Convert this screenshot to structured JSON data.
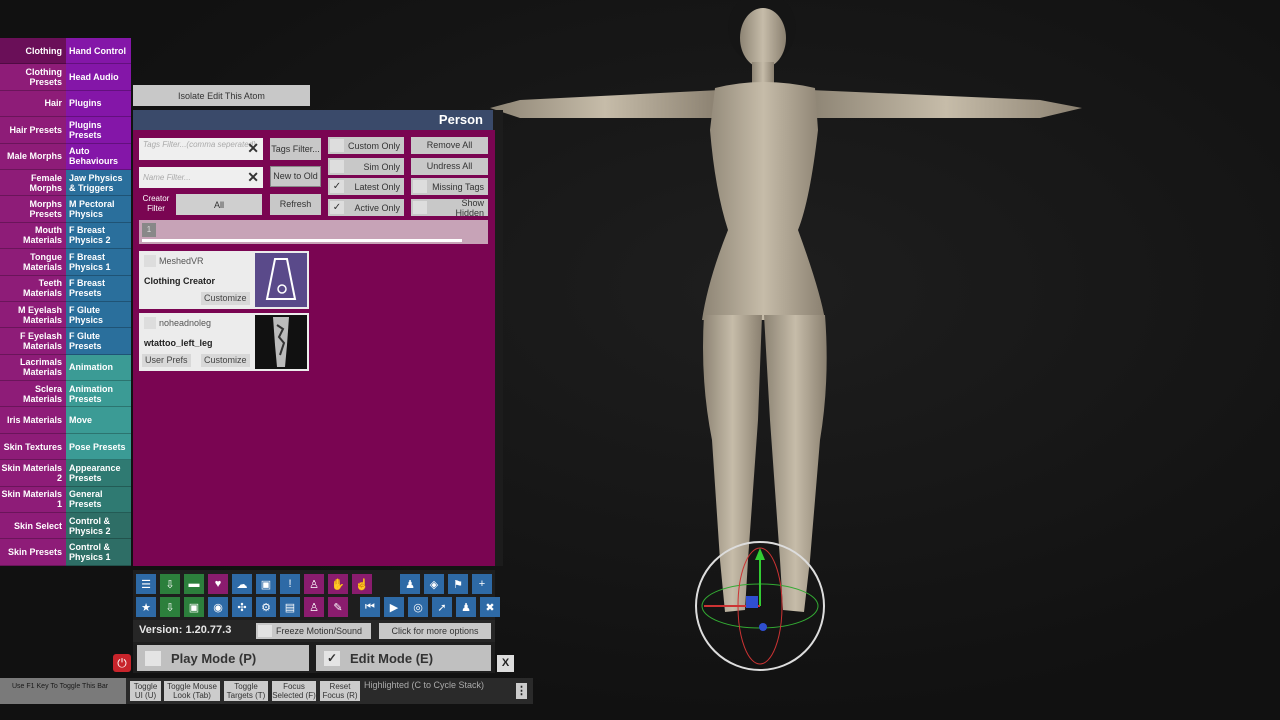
{
  "left_tabs": [
    {
      "label": "Clothing",
      "active": true
    },
    {
      "label": "Clothing Presets"
    },
    {
      "label": "Hair"
    },
    {
      "label": "Hair Presets"
    },
    {
      "label": "Male Morphs"
    },
    {
      "label": "Female Morphs"
    },
    {
      "label": "Morphs Presets"
    },
    {
      "label": "Mouth Materials"
    },
    {
      "label": "Tongue Materials"
    },
    {
      "label": "Teeth Materials"
    },
    {
      "label": "M Eyelash Materials"
    },
    {
      "label": "F Eyelash Materials"
    },
    {
      "label": "Lacrimals Materials"
    },
    {
      "label": "Sclera Materials"
    },
    {
      "label": "Iris Materials"
    },
    {
      "label": "Skin Textures"
    },
    {
      "label": "Skin Materials 2"
    },
    {
      "label": "Skin Materials 1"
    },
    {
      "label": "Skin Select"
    },
    {
      "label": "Skin Presets"
    }
  ],
  "right_tabs": [
    {
      "label": "Hand Control",
      "color": "purple"
    },
    {
      "label": "Head Audio",
      "color": "purple"
    },
    {
      "label": "Plugins",
      "color": "purple"
    },
    {
      "label": "Plugins Presets",
      "color": "purple"
    },
    {
      "label": "Auto Behaviours",
      "color": "purple"
    },
    {
      "label": "Jaw Physics & Triggers",
      "color": "blue"
    },
    {
      "label": "M Pectoral Physics",
      "color": "blue"
    },
    {
      "label": "F Breast Physics 2",
      "color": "blue"
    },
    {
      "label": "F Breast Physics 1",
      "color": "blue"
    },
    {
      "label": "F Breast Presets",
      "color": "blue"
    },
    {
      "label": "F Glute Physics",
      "color": "blue"
    },
    {
      "label": "F Glute Presets",
      "color": "blue"
    },
    {
      "label": "Animation",
      "color": "teal"
    },
    {
      "label": "Animation Presets",
      "color": "teal"
    },
    {
      "label": "Move",
      "color": "teal"
    },
    {
      "label": "Pose Presets",
      "color": "teal"
    },
    {
      "label": "Appearance Presets",
      "color": "dteal"
    },
    {
      "label": "General Presets",
      "color": "dteal"
    },
    {
      "label": "Control & Physics 2",
      "color": "gteal"
    },
    {
      "label": "Control & Physics 1",
      "color": "gteal"
    }
  ],
  "isolate_button": "Isolate Edit This Atom",
  "panel": {
    "title": "Person",
    "tags_filter_placeholder": "Tags Filter...(comma seperated)",
    "name_filter_placeholder": "Name Filter...",
    "tags_filter_button": "Tags Filter...",
    "sort_button": "New to Old",
    "refresh_button": "Refresh",
    "creator_filter_label": "Creator Filter",
    "creator_filter_value": "All",
    "toggles": [
      {
        "label": "Custom Only",
        "checked": false
      },
      {
        "label": "Sim Only",
        "checked": false
      },
      {
        "label": "Latest Only",
        "checked": true
      },
      {
        "label": "Active Only",
        "checked": true
      }
    ],
    "right_buttons": {
      "remove_all": "Remove All",
      "undress_all": "Undress All",
      "missing_tags": "Missing Tags",
      "show_hidden": "Show Hidden"
    },
    "page_number": "1",
    "items": [
      {
        "creator": "MeshedVR",
        "name": "Clothing Creator",
        "buttons": [
          "Customize"
        ]
      },
      {
        "creator": "noheadnoleg",
        "name": "wtattoo_left_leg",
        "buttons": [
          "User Prefs",
          "Customize"
        ]
      }
    ]
  },
  "toolbar": {
    "version": "Version: 1.20.77.3",
    "freeze": "Freeze Motion/Sound",
    "more_options": "Click for more options",
    "play_mode": "Play Mode (P)",
    "edit_mode": "Edit Mode (E)",
    "close": "X",
    "icons_row1": [
      "menu-icon",
      "save-scene-icon",
      "open-folder-icon",
      "hub-icon",
      "cloud-download-icon",
      "package-icon",
      "info-icon",
      "person-status-icon",
      "hand-icon",
      "grab-icon",
      "person-icon",
      "unity-icon",
      "flag-icon",
      "add-icon"
    ],
    "icons_row2": [
      "favorite-icon",
      "save-as-icon",
      "screenshot-folder-icon",
      "camera-icon",
      "network-icon",
      "package-settings-icon",
      "document-icon",
      "person-settings-icon",
      "plugin-icon",
      "skip-back-icon",
      "play-icon",
      "target-icon",
      "cursor-icon",
      "people-icon",
      "tools-icon"
    ]
  },
  "statusbar": {
    "f1_hint": "Use F1 Key To Toggle This Bar",
    "buttons": [
      "Toggle UI (U)",
      "Toggle Mouse Look (Tab)",
      "Toggle Targets (T)",
      "Focus Selected (F)",
      "Reset Focus (R)"
    ],
    "highlighted": "Highlighted (C to Cycle Stack)",
    "menu": "⋮"
  }
}
